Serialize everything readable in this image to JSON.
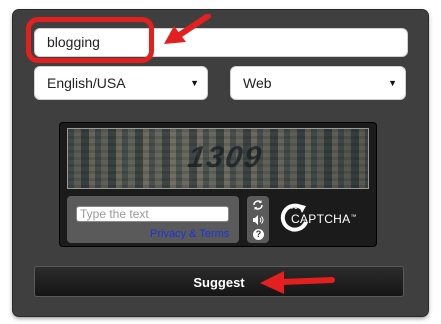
{
  "search": {
    "keyword_value": "blogging"
  },
  "filters": {
    "language": {
      "selected": "English/USA"
    },
    "type": {
      "selected": "Web"
    }
  },
  "captcha": {
    "distorted_word": "1309",
    "input_placeholder": "Type the text",
    "privacy_link": "Privacy & Terms",
    "brand": {
      "prefix": "re",
      "name": "CAPTCHA",
      "tm": "™"
    },
    "tools": {
      "refresh_icon": "refresh-icon",
      "audio_icon": "audio-icon",
      "help_label": "?"
    }
  },
  "actions": {
    "suggest_label": "Suggest"
  },
  "annotations": {
    "highlight_color": "#e41f1f"
  }
}
